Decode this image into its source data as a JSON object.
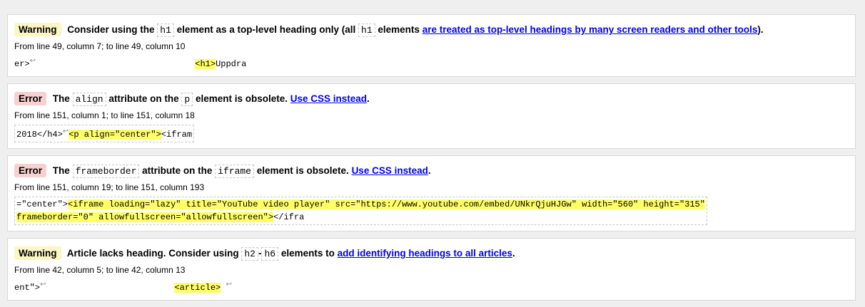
{
  "messages": [
    {
      "type_label": "Warning",
      "parts": {
        "a": "Consider using the",
        "code1": "h1",
        "b": "element as a top-level heading only (all",
        "code2": "h1",
        "c": "elements",
        "link": "are treated as top-level headings by many screen readers and other tools",
        "d": ")."
      },
      "location": "From line 49, column 7; to line 49, column 10",
      "extract_pre": "er>",
      "extract_gap": "                               ",
      "extract_hl": "<h1>",
      "extract_post": "Uppdra"
    },
    {
      "type_label": "Error",
      "parts": {
        "a": "The",
        "code1": "align",
        "b": "attribute on the",
        "code2": "p",
        "c": "element is obsolete.",
        "link": "Use CSS instead",
        "d": "."
      },
      "location": "From line 151, column 1; to line 151, column 18",
      "extract_pre": "2018</h4>",
      "extract_hl": "<p align=\"center\">",
      "extract_post": "<ifram"
    },
    {
      "type_label": "Error",
      "parts": {
        "a": "The",
        "code1": "frameborder",
        "b": "attribute on the",
        "code2": "iframe",
        "c": "element is obsolete.",
        "link": "Use CSS instead",
        "d": "."
      },
      "location": "From line 151, column 19; to line 151, column 193",
      "extract_pre": "=\"center\">",
      "extract_hl1": "<iframe loading=\"lazy\" title=\"YouTube video player\" src=\"https://www.youtube.com/embed/UNkrQjuHJGw\" width=\"560\" height=\"315\"",
      "extract_hl2": "frameborder=\"0\" allowfullscreen=\"allowfullscreen\">",
      "extract_post": "</ifra"
    },
    {
      "type_label": "Warning",
      "parts": {
        "a": "Article lacks heading. Consider using",
        "code1": "h2",
        "b": "-",
        "code2": "h6",
        "c": "elements to",
        "link": "add identifying headings to all articles",
        "d": "."
      },
      "location": "From line 42, column 5; to line 42, column 13",
      "extract_pre": "ent\">",
      "extract_gap": "                         ",
      "extract_hl": "<article>",
      "extract_post": " "
    }
  ],
  "symbols": {
    "return": "↩"
  }
}
